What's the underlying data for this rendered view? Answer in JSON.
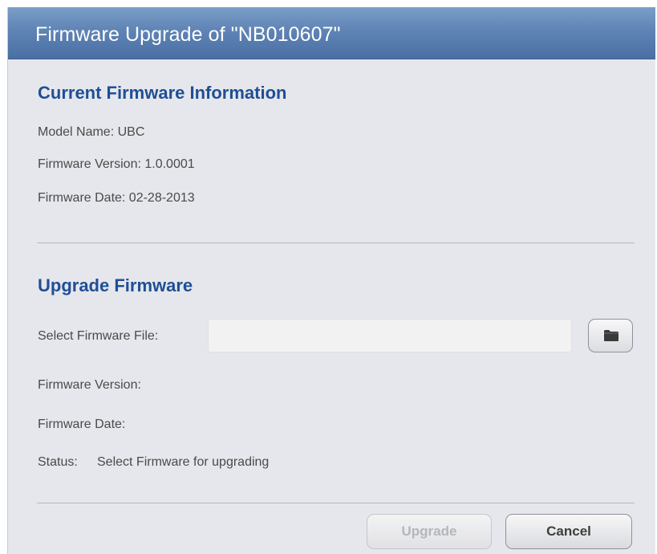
{
  "dialog": {
    "title": "Firmware Upgrade of \"NB010607\""
  },
  "current": {
    "heading": "Current Firmware Information",
    "model_name": "Model Name: UBC",
    "firmware_version": "Firmware Version: 1.0.0001",
    "firmware_date": "Firmware Date: 02-28-2013"
  },
  "upgrade": {
    "heading": "Upgrade Firmware",
    "select_label": "Select Firmware File:",
    "file_value": "",
    "browse_icon": "folder-icon",
    "firmware_version_label": "Firmware Version:",
    "firmware_date_label": "Firmware Date:",
    "status_label": "Status:",
    "status_value": "Select Firmware for upgrading"
  },
  "buttons": {
    "upgrade_label": "Upgrade",
    "upgrade_enabled": false,
    "cancel_label": "Cancel"
  },
  "colors": {
    "titlebar": "#5f84b5",
    "heading": "#1f4f95",
    "background": "#e6e7ec"
  }
}
